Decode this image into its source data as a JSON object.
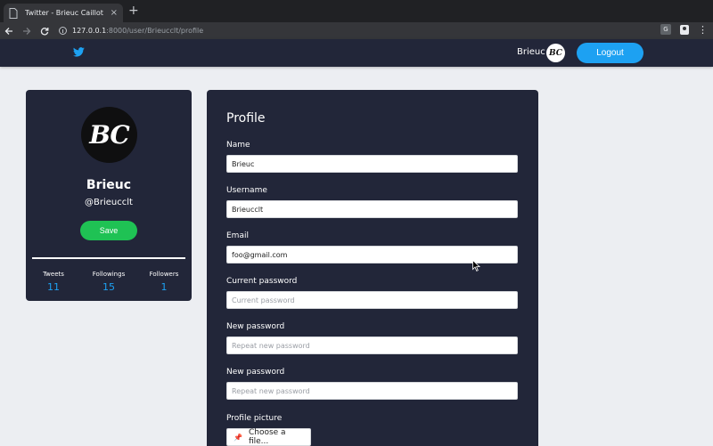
{
  "browser": {
    "tab_title": "Twitter - Brieuc Caillot",
    "tab_close": "×",
    "new_tab": "+",
    "url_host": "127.0.0.1",
    "url_rest": ":8000/user/Brieucclt/profile"
  },
  "nav": {
    "username": "Brieuc",
    "avatar_initials": "BC",
    "logout_label": "Logout"
  },
  "profile_card": {
    "avatar_initials": "BC",
    "name": "Brieuc",
    "handle": "@Brieucclt",
    "save_label": "Save",
    "stats": [
      {
        "label": "Tweets",
        "value": "11"
      },
      {
        "label": "Followings",
        "value": "15"
      },
      {
        "label": "Followers",
        "value": "1"
      }
    ]
  },
  "form": {
    "title": "Profile",
    "fields": [
      {
        "label": "Name",
        "value": "Brieuc",
        "placeholder": ""
      },
      {
        "label": "Username",
        "value": "Brieucclt",
        "placeholder": ""
      },
      {
        "label": "Email",
        "value": "foo@gmail.com",
        "placeholder": ""
      },
      {
        "label": "Current password",
        "value": "",
        "placeholder": "Current password"
      },
      {
        "label": "New password",
        "value": "",
        "placeholder": "Repeat new password"
      },
      {
        "label": "New password",
        "value": "",
        "placeholder": "Repeat new password"
      }
    ],
    "picture_label": "Profile picture",
    "file_button_label": "Choose a file..."
  },
  "colors": {
    "nav_bg": "#222639",
    "accent": "#1da1f2",
    "save_green": "#1fc254",
    "page_bg": "#eceef2"
  }
}
